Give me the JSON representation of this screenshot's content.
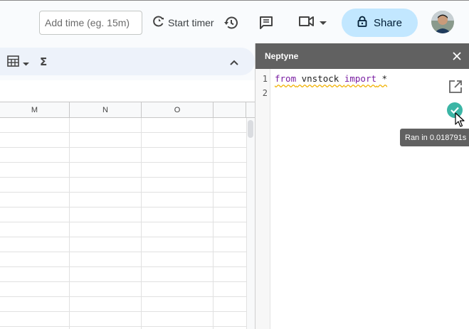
{
  "header": {
    "time_placeholder": "Add time (eg. 15m)",
    "start_timer_label": "Start timer",
    "share_label": "Share",
    "icons": [
      "timer-icon",
      "history-icon",
      "comment-icon",
      "meet-icon",
      "chevron-down-icon",
      "lock-icon"
    ]
  },
  "toolbar": {
    "icons": [
      "table-icon",
      "dropdown-caret-icon",
      "sigma-icon",
      "collapse-up-icon"
    ],
    "sigma": "Σ"
  },
  "sheet": {
    "columns": [
      "M",
      "N",
      "O",
      ""
    ]
  },
  "panel": {
    "title": "Neptyne",
    "line_numbers": [
      "1",
      "2"
    ],
    "code": {
      "kw1": "from",
      "module": " vnstock ",
      "kw2": "import",
      "rest": " *"
    },
    "tooltip": "Ran in 0.018791s",
    "status_color": "#3bb5a5"
  },
  "colors": {
    "share_bg": "#c2e7ff",
    "panel_header_bg": "#616161",
    "toolbar_bg": "#edf2fa"
  }
}
